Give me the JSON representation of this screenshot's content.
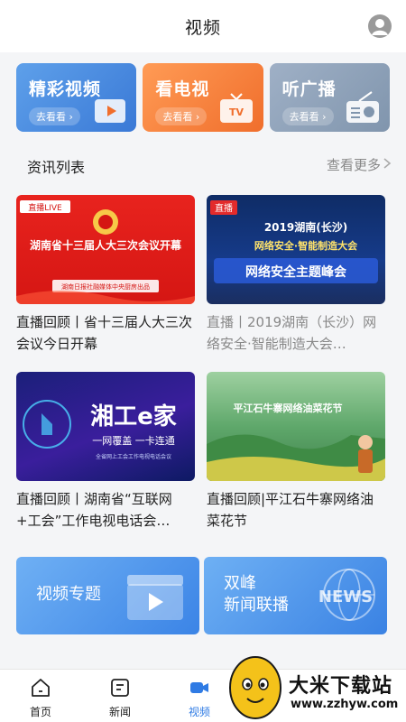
{
  "header": {
    "title": "视频"
  },
  "categories": [
    {
      "title": "精彩视频",
      "sub": "去看看 ›"
    },
    {
      "title": "看电视",
      "sub": "去看看 ›"
    },
    {
      "title": "听广播",
      "sub": "去看看 ›"
    }
  ],
  "section": {
    "title": "资讯列表",
    "more": "查看更多"
  },
  "cards": [
    {
      "caption": "直播回顾丨省十三届人大三次会议今日开幕",
      "muted": false,
      "thumb_texts": {
        "logo": "直播LIVE",
        "headline": "湖南省十三届人大三次会议开幕",
        "footer": "湖南日报社融媒体中央厨房出品"
      }
    },
    {
      "caption": "直播丨2019湖南（长沙）网络安全·智能制造大会…",
      "muted": true,
      "thumb_texts": {
        "badge": "直播",
        "line1": "2019湖南(长沙)",
        "line2": "网络安全·智能制造大会",
        "line3": "网络安全主题峰会"
      }
    },
    {
      "caption": "直播回顾丨湖南省“互联网+工会”工作电视电话会…",
      "muted": false,
      "thumb_texts": {
        "headline": "湘工e家",
        "slogan": "一网覆盖  一卡连通",
        "small": "全省网上工会工作电视电话会议"
      }
    },
    {
      "caption": "直播回顾|平江石牛寨网络油菜花节",
      "muted": false,
      "thumb_texts": {
        "headline": "平江石牛寨网络油菜花节"
      }
    }
  ],
  "promos": [
    {
      "title_lines": [
        "视频专题"
      ]
    },
    {
      "title_lines": [
        "双峰",
        "新闻联播"
      ],
      "badge": "NEWS"
    }
  ],
  "tabbar": [
    {
      "label": "首页",
      "icon": "home-icon"
    },
    {
      "label": "新闻",
      "icon": "news-icon"
    },
    {
      "label": "视频",
      "icon": "video-icon",
      "active": true
    }
  ],
  "watermark": {
    "name": "大米下载站",
    "url": "www.zzhyw.com"
  },
  "colors": {
    "accent": "#2f7be4",
    "cat1": "#4a8ce0",
    "cat2": "#f5803e",
    "cat3": "#8fa2ba"
  }
}
